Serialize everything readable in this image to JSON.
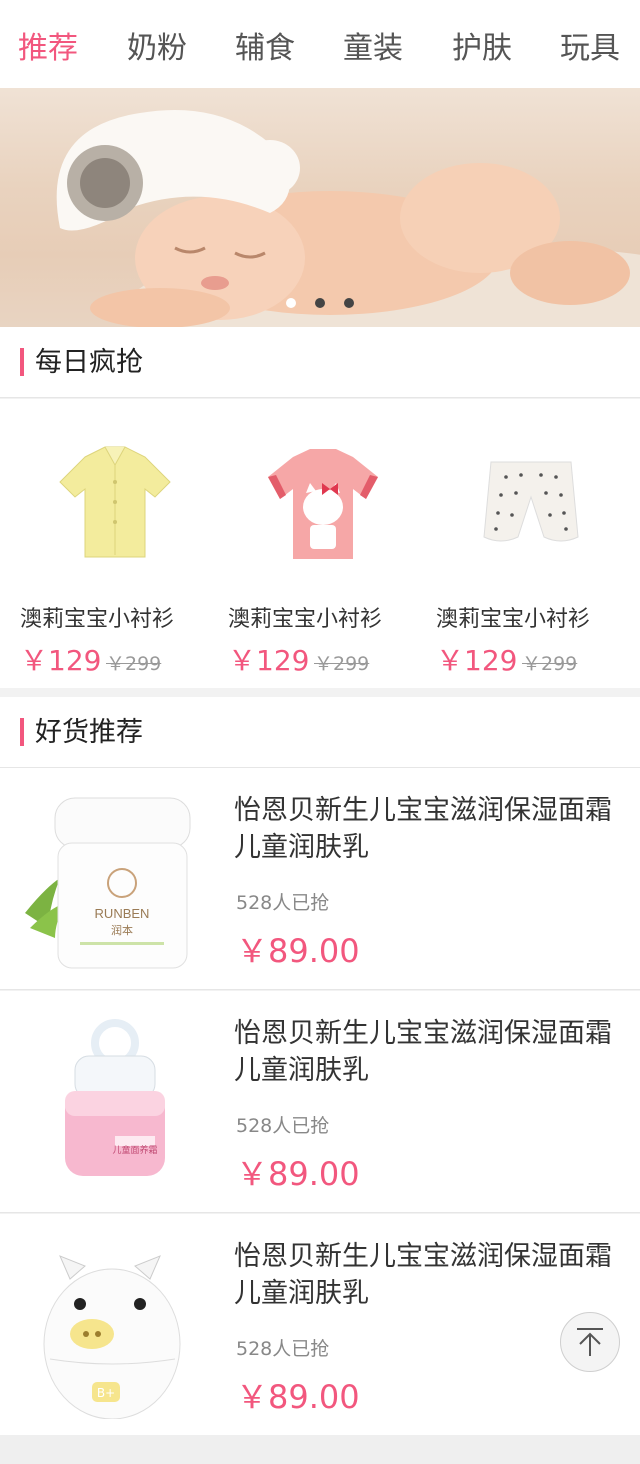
{
  "tabs": [
    {
      "label": "推荐",
      "active": true
    },
    {
      "label": "奶粉",
      "active": false
    },
    {
      "label": "辅食",
      "active": false
    },
    {
      "label": "童装",
      "active": false
    },
    {
      "label": "护肤",
      "active": false
    },
    {
      "label": "玩具",
      "active": false
    }
  ],
  "banner": {
    "slides": 3,
    "active_slide": 1
  },
  "daily_section": {
    "title": "每日疯抢"
  },
  "daily_items": [
    {
      "name": "澳莉宝宝小衬衫",
      "price": "￥129",
      "original_price": "￥299",
      "image": "yellow-shirt"
    },
    {
      "name": "澳莉宝宝小衬衫",
      "price": "￥129",
      "original_price": "￥299",
      "image": "pink-cat-tee"
    },
    {
      "name": "澳莉宝宝小衬衫",
      "price": "￥129",
      "original_price": "￥299",
      "image": "white-shorts"
    }
  ],
  "recommend_section": {
    "title": "好货推荐"
  },
  "recommend_items": [
    {
      "title": "怡恩贝新生儿宝宝滋润保湿面霜儿童润肤乳",
      "sold": "528人已抢",
      "price": "￥89.00",
      "image": "runben-cream-jar",
      "brand": "RUNBEN",
      "brand_cn": "润本"
    },
    {
      "title": "怡恩贝新生儿宝宝滋润保湿面霜儿童润肤乳",
      "sold": "528人已抢",
      "price": "￥89.00",
      "image": "pink-cream-jar",
      "product_label": "儿童面养霜"
    },
    {
      "title": "怡恩贝新生儿宝宝滋润保湿面霜儿童润肤乳",
      "sold": "528人已抢",
      "price": "￥89.00",
      "image": "pig-cream-jar",
      "badge": "B+"
    }
  ],
  "back_to_top": {
    "icon": "arrow-up-icon"
  },
  "colors": {
    "accent": "#f2577e",
    "text": "#333333",
    "muted": "#999999",
    "background": "#f2f2f2"
  }
}
